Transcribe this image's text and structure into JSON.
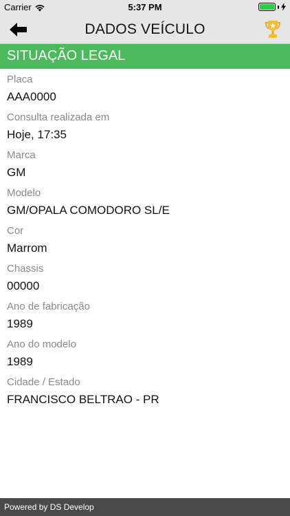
{
  "status_bar": {
    "carrier": "Carrier",
    "time": "5:37 PM",
    "wifi_icon": "wifi-icon",
    "battery_icon": "battery-icon",
    "charging_icon": "charging-bolt-icon"
  },
  "nav": {
    "title": "DADOS VEÍCULO",
    "back_icon": "back-arrow-icon",
    "trophy_icon": "trophy-icon"
  },
  "section": {
    "title": "SITUAÇÃO LEGAL",
    "color": "#4cba5c"
  },
  "fields": [
    {
      "label": "Placa",
      "value": "AAA0000"
    },
    {
      "label": "Consulta realizada em",
      "value": "Hoje, 17:35"
    },
    {
      "label": "Marca",
      "value": "GM"
    },
    {
      "label": "Modelo",
      "value": "GM/OPALA COMODORO SL/E"
    },
    {
      "label": "Cor",
      "value": "Marrom"
    },
    {
      "label": "Chassis",
      "value": "00000"
    },
    {
      "label": "Ano de fabricação",
      "value": "1989"
    },
    {
      "label": "Ano do modelo",
      "value": "1989"
    },
    {
      "label": "Cidade / Estado",
      "value": "FRANCISCO BELTRAO - PR"
    }
  ],
  "footer": {
    "text": "Powered by DS Develop"
  }
}
